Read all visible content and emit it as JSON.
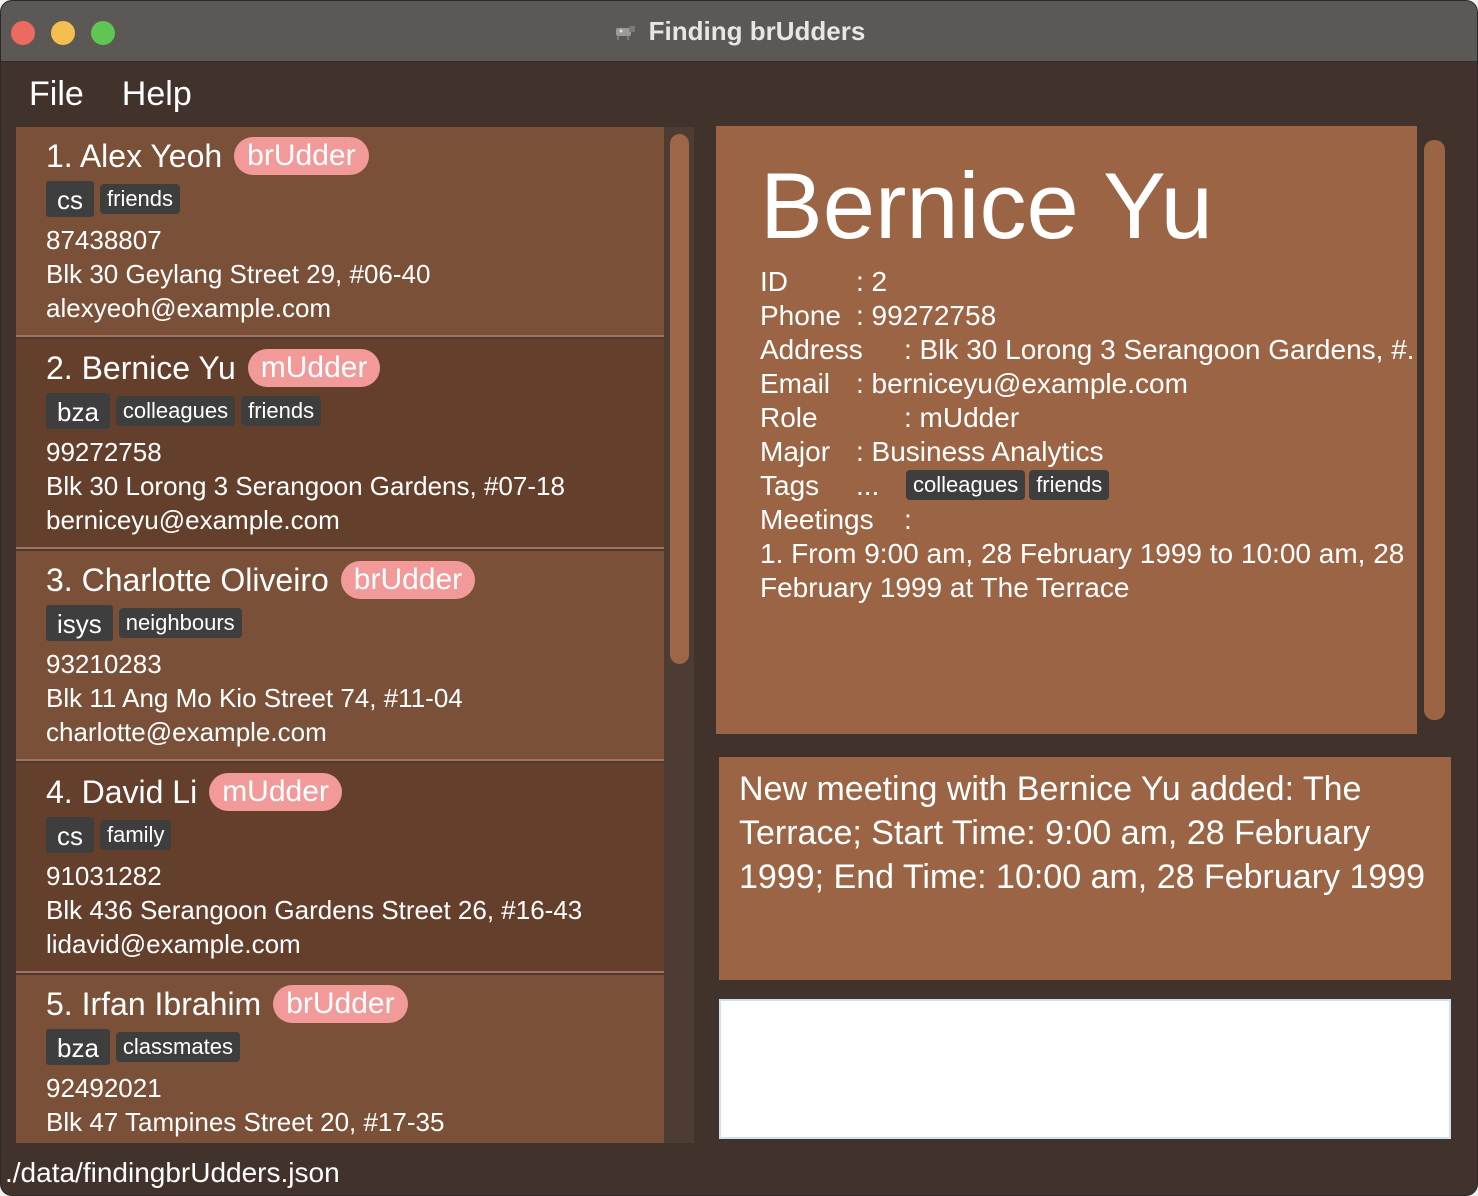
{
  "window": {
    "title": "Finding brUdders"
  },
  "menu": [
    {
      "label": "File"
    },
    {
      "label": "Help"
    }
  ],
  "persons": [
    {
      "index_name": "1. Alex Yeoh",
      "role": "brUdder",
      "major": "cs",
      "tags": [
        "friends"
      ],
      "phone": "87438807",
      "address": "Blk 30 Geylang Street 29, #06-40",
      "email": "alexyeoh@example.com"
    },
    {
      "index_name": "2. Bernice Yu",
      "role": "mUdder",
      "major": "bza",
      "tags": [
        "colleagues",
        "friends"
      ],
      "phone": "99272758",
      "address": "Blk 30 Lorong 3 Serangoon Gardens, #07-18",
      "email": "berniceyu@example.com"
    },
    {
      "index_name": "3. Charlotte Oliveiro",
      "role": "brUdder",
      "major": "isys",
      "tags": [
        "neighbours"
      ],
      "phone": "93210283",
      "address": "Blk 11 Ang Mo Kio Street 74, #11-04",
      "email": "charlotte@example.com"
    },
    {
      "index_name": "4. David Li",
      "role": "mUdder",
      "major": "cs",
      "tags": [
        "family"
      ],
      "phone": "91031282",
      "address": "Blk 436 Serangoon Gardens Street 26, #16-43",
      "email": "lidavid@example.com"
    },
    {
      "index_name": "5. Irfan Ibrahim",
      "role": "brUdder",
      "major": "bza",
      "tags": [
        "classmates"
      ],
      "phone": "92492021",
      "address": "Blk 47 Tampines Street 20, #17-35",
      "email": ""
    }
  ],
  "detail": {
    "name": "Bernice Yu",
    "id_label": "ID",
    "id_value": ": 2",
    "phone_label": "Phone",
    "phone_value": ": 99272758",
    "address_label": "Address",
    "address_value": ": Blk 30 Lorong 3 Serangoon Gardens, #...",
    "email_label": "Email",
    "email_value": ": berniceyu@example.com",
    "role_label": "Role",
    "role_value": ": mUdder",
    "major_label": "Major",
    "major_value": ": Business Analytics",
    "tags_label": "Tags",
    "tags_sep": "...",
    "tags": [
      "colleagues",
      "friends"
    ],
    "meetings_label": "Meetings",
    "meetings_sep": ":",
    "meeting_line1": "1. From 9:00 am, 28 February 1999 to 10:00 am, 28",
    "meeting_line2": "February 1999 at The Terrace"
  },
  "result": {
    "line1": "New meeting with Bernice Yu added: The",
    "line2": "Terrace; Start Time: 9:00 am, 28 February",
    "line3": "1999; End Time: 10:00 am, 28 February 1999"
  },
  "command": {
    "value": "",
    "placeholder": ""
  },
  "status": {
    "path": "./data/findingbrUdders.json"
  }
}
